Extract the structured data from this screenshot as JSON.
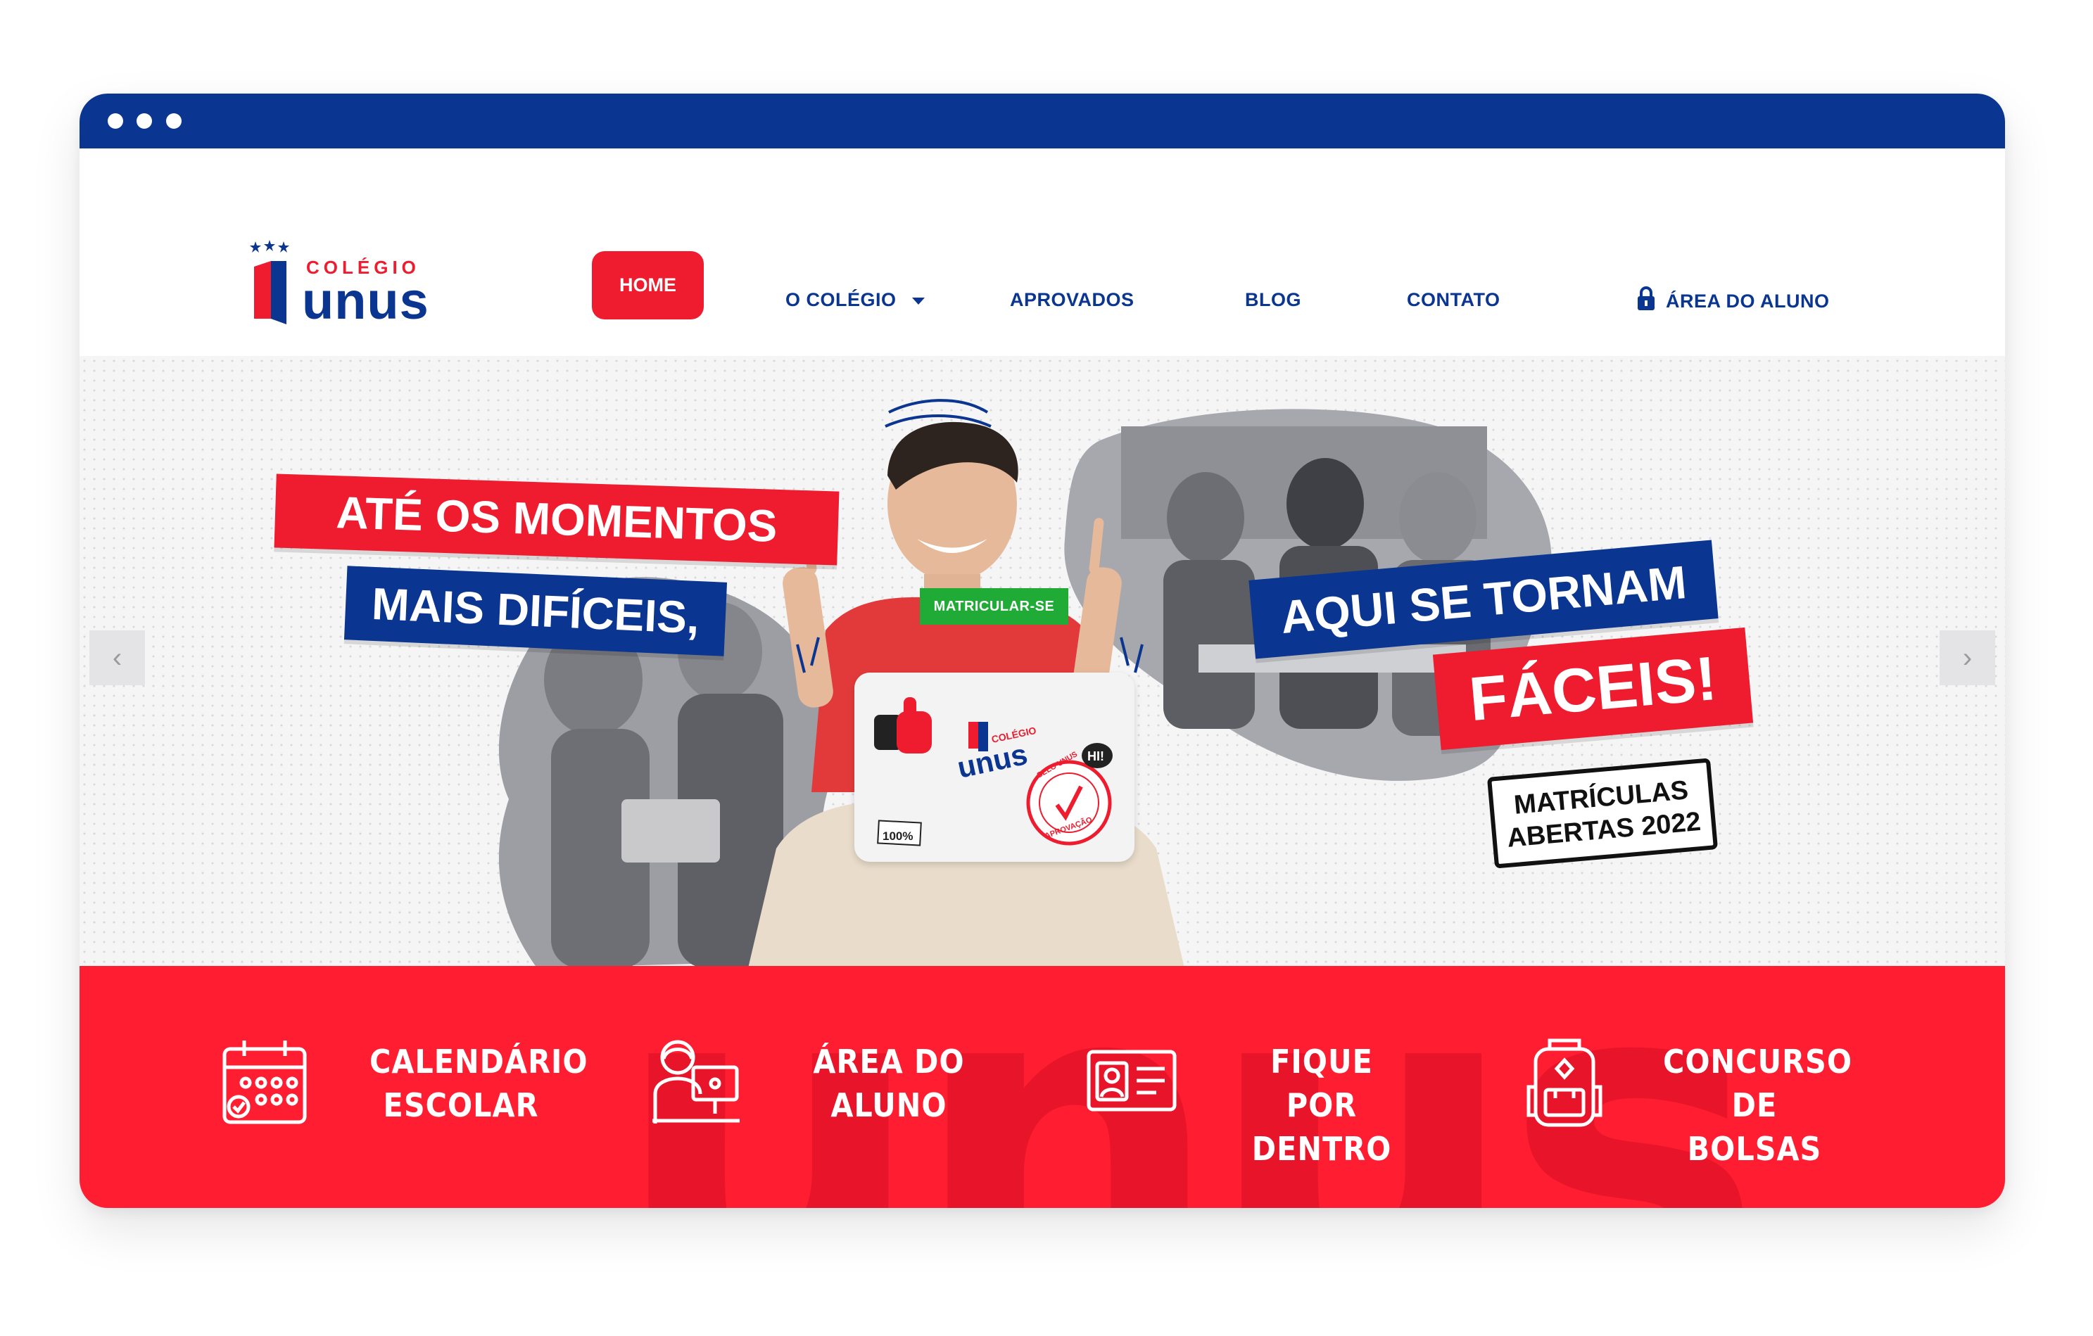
{
  "logo": {
    "word_small": "COLÉGIO",
    "word_big": "unus"
  },
  "nav": {
    "home": "HOME",
    "colegio": "O COLÉGIO",
    "aprovados": "APROVADOS",
    "blog": "BLOG",
    "contato": "CONTATO",
    "area_aluno": "ÁREA DO ALUNO"
  },
  "hero": {
    "line1": "ATÉ OS MOMENTOS",
    "line2": "MAIS DIFÍCEIS,",
    "line3": "AQUI SE TORNAM",
    "line4": "FÁCEIS!",
    "stamp_line1": "MATRÍCULAS",
    "stamp_line2": "ABERTAS 2022",
    "cta": "MATRICULAR-SE",
    "laptop_logo_small": "COLÉGIO",
    "laptop_logo_big": "unus",
    "sticker_hi": "HI!",
    "sticker_100": "100%",
    "sticker_selo": "SELO UNUS",
    "sticker_aprovacao": "APROVAÇÃO"
  },
  "carousel": {
    "prev": "‹",
    "next": "›"
  },
  "features": [
    {
      "line1": "CALENDÁRIO",
      "line2": "ESCOLAR",
      "icon": "calendar-icon"
    },
    {
      "line1": "ÁREA DO",
      "line2": "ALUNO",
      "icon": "student-computer-icon"
    },
    {
      "line1": "FIQUE POR",
      "line2": "DENTRO",
      "icon": "id-card-icon"
    },
    {
      "line1": "CONCURSO",
      "line2": "DE BOLSAS",
      "icon": "backpack-icon"
    }
  ],
  "watermark": "unus",
  "colors": {
    "brand_blue": "#0a3591",
    "brand_red": "#ee1c2e",
    "cta_green": "#1fab35"
  }
}
